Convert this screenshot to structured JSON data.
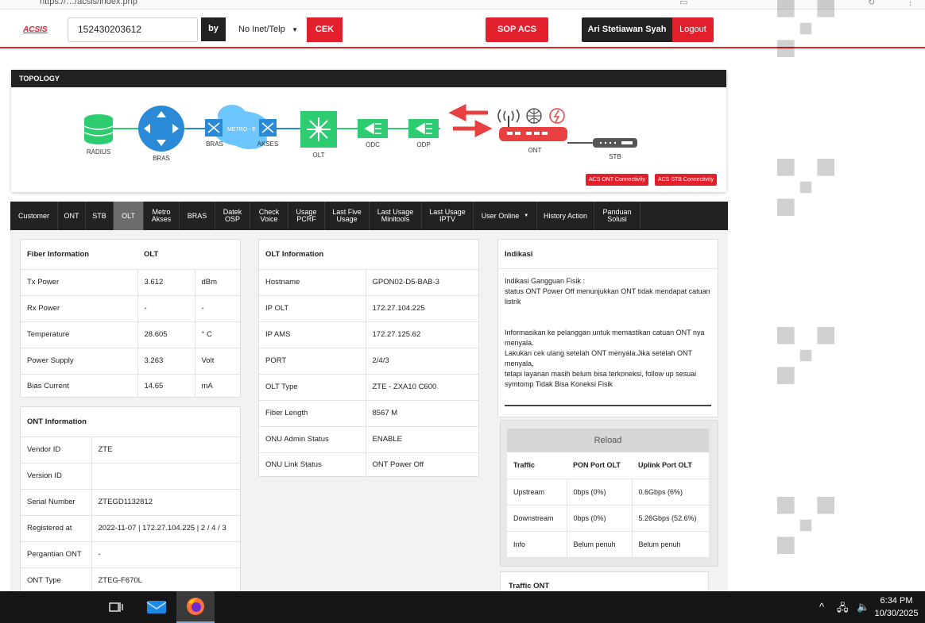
{
  "header": {
    "logo": "ACSIS",
    "search_value": "152430203612",
    "by_label": "by",
    "select_value": "No Inet/Telp",
    "cek_label": "CEK",
    "sop_label": "SOP ACS",
    "user_name": "Ari Stetiawan Syah",
    "logout_label": "Logout"
  },
  "topology": {
    "title": "TOPOLOGY",
    "nodes": [
      "RADIUS",
      "BRAS",
      "BRAS",
      "METRO - E",
      "AKSES",
      "OLT",
      "ODC",
      "ODP",
      "ONT",
      "STB"
    ],
    "buttons": [
      "ACS ONT Connectivity",
      "ACS STB Connectivity"
    ]
  },
  "tabs": [
    {
      "label": "Customer"
    },
    {
      "label": "ONT"
    },
    {
      "label": "STB"
    },
    {
      "label": "OLT",
      "active": true
    },
    {
      "label": "Metro Akses"
    },
    {
      "label": "BRAS"
    },
    {
      "label": "Datek OSP"
    },
    {
      "label": "Check Voice"
    },
    {
      "label": "Usage PCRF"
    },
    {
      "label": "Last Five Usage"
    },
    {
      "label": "Last Usage Minitools"
    },
    {
      "label": "Last Usage IPTV"
    },
    {
      "label": "User Online"
    },
    {
      "label": "History Action"
    },
    {
      "label": "Panduan Solusi"
    }
  ],
  "fiber": {
    "h1": "Fiber Information",
    "h2": "OLT",
    "rows": [
      {
        "k": "Tx Power",
        "v": "3.612",
        "u": "dBm"
      },
      {
        "k": "Rx Power",
        "v": "-",
        "u": "-"
      },
      {
        "k": "Temperature",
        "v": "28.605",
        "u": "° C"
      },
      {
        "k": "Power Supply",
        "v": "3.263",
        "u": "Volt"
      },
      {
        "k": "Bias Current",
        "v": "14.65",
        "u": "mA"
      }
    ]
  },
  "ont": {
    "h": "ONT Information",
    "rows": [
      {
        "k": "Vendor ID",
        "v": "ZTE"
      },
      {
        "k": "Version ID",
        "v": ""
      },
      {
        "k": "Serial Number",
        "v": "ZTEGD1132812"
      },
      {
        "k": "Registered at",
        "v": "2022-11-07 | 172.27.104.225 | 2 / 4 / 3"
      },
      {
        "k": "Pergantian ONT",
        "v": "-"
      },
      {
        "k": "ONT Type",
        "v": "ZTEG-F670L"
      }
    ]
  },
  "olt": {
    "h": "OLT Information",
    "rows": [
      {
        "k": "Hostname",
        "v": "GPON02-D5-BAB-3"
      },
      {
        "k": "IP OLT",
        "v": "172.27.104.225"
      },
      {
        "k": "IP AMS",
        "v": "172.27.125.62"
      },
      {
        "k": "PORT",
        "v": "2/4/3"
      },
      {
        "k": "OLT Type",
        "v": "ZTE - ZXA10 C600"
      },
      {
        "k": "Fiber Length",
        "v": "8567 M"
      },
      {
        "k": "ONU Admin Status",
        "v": "ENABLE"
      },
      {
        "k": "ONU Link Status",
        "v": "ONT Power Off"
      }
    ]
  },
  "indikasi": {
    "h": "Indikasi",
    "lines": [
      "Indikasi Gangguan Fisik :",
      "status ONT Power Off menunjukkan ONT tidak mendapat catuan listrik",
      "",
      "",
      "Informasikan ke pelanggan untuk memastikan catuan ONT nya menyala.",
      "Lakukan cek ulang setelah ONT menyala.Jika setelah ONT menyala,",
      "tetapi layanan masih belum bisa terkoneksi, follow up sesuai symtomp Tidak Bisa Koneksi Fisik"
    ]
  },
  "traffic": {
    "reload_label": "Reload",
    "headers": [
      "Traffic",
      "PON Port OLT",
      "Uplink Port OLT"
    ],
    "rows": [
      [
        "Upstream",
        "0bps (0%)",
        "0.6Gbps (6%)"
      ],
      [
        "Downstream",
        "0bps (0%)",
        "5.26Gbps (52.6%)"
      ],
      [
        "Info",
        "Belum penuh",
        "Belum penuh"
      ]
    ],
    "traffic_ont_label": "Traffic ONT"
  },
  "taskbar": {
    "time": "6:34 PM",
    "date": "10/30/2025"
  },
  "colors": {
    "accent": "#e2202b",
    "dark": "#222222",
    "green": "#2ecc71",
    "blue": "#2a8ad8"
  }
}
